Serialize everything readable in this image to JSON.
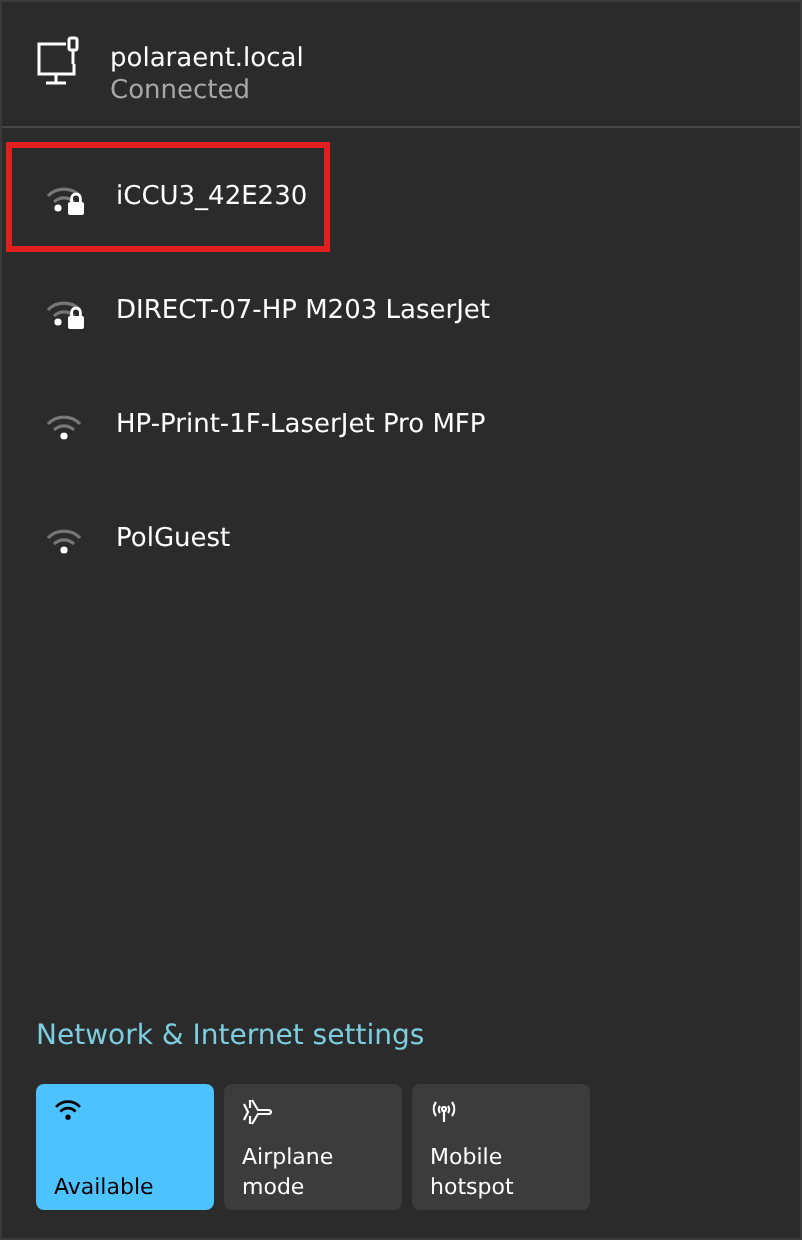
{
  "connection": {
    "name": "polaraent.local",
    "status": "Connected"
  },
  "networks": [
    {
      "name": "iCCU3_42E230",
      "secured": true,
      "highlighted": true
    },
    {
      "name": "DIRECT-07-HP M203 LaserJet",
      "secured": true,
      "highlighted": false
    },
    {
      "name": "HP-Print-1F-LaserJet Pro MFP",
      "secured": false,
      "highlighted": false
    },
    {
      "name": "PolGuest",
      "secured": false,
      "highlighted": false
    }
  ],
  "settings_link": "Network & Internet settings",
  "quick_actions": [
    {
      "kind": "wifi",
      "label": "Available",
      "on": true
    },
    {
      "kind": "airplane",
      "label": "Airplane mode",
      "on": false
    },
    {
      "kind": "hotspot",
      "label": "Mobile hotspot",
      "on": false
    }
  ]
}
